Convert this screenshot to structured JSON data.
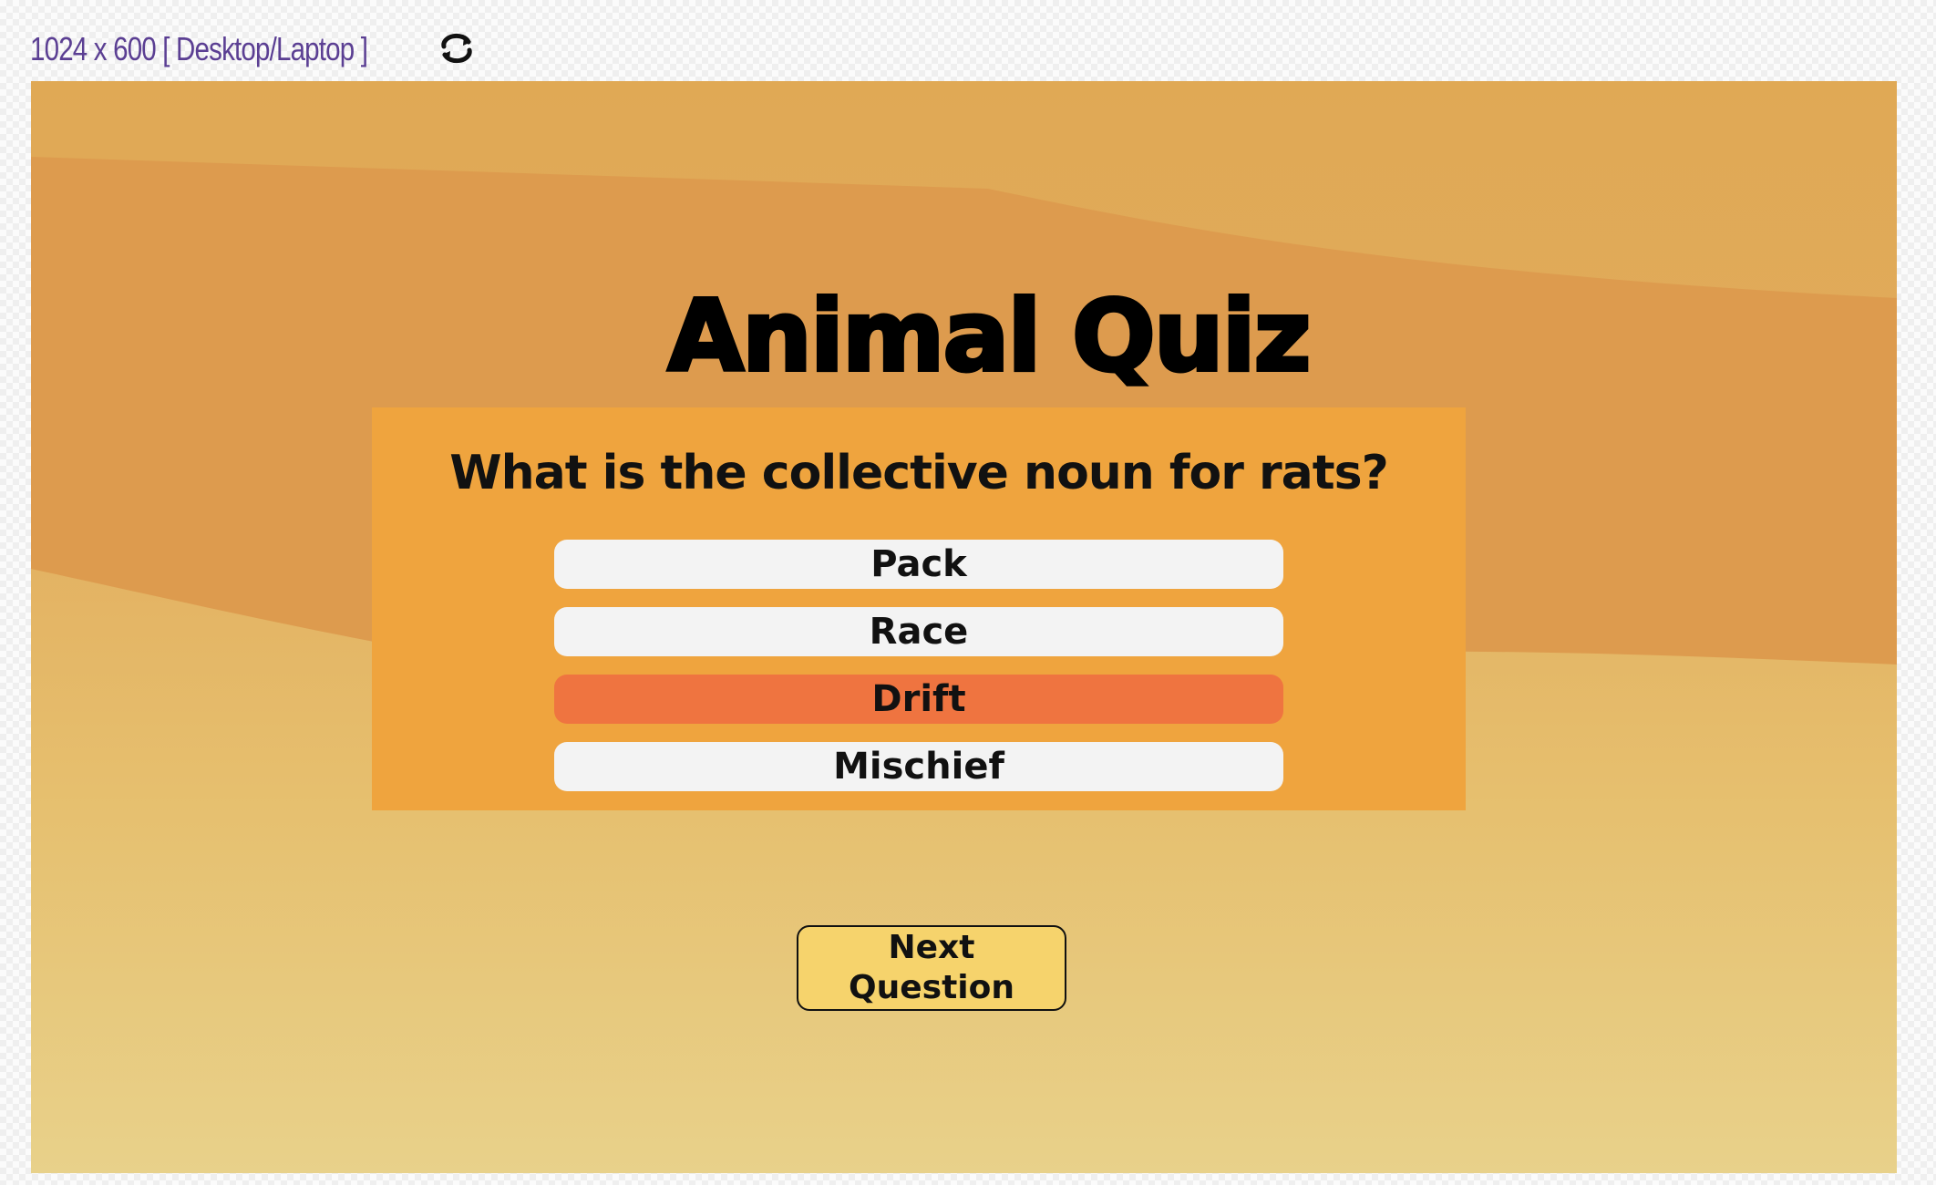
{
  "toolbar": {
    "device_label": "1024 x 600 [ Desktop/Laptop ]",
    "rotate_icon": "rotate-icon"
  },
  "quiz": {
    "title": "Animal Quiz",
    "question": "What is the collective noun for rats?",
    "answers": [
      {
        "label": "Pack",
        "selected": false
      },
      {
        "label": "Race",
        "selected": false
      },
      {
        "label": "Drift",
        "selected": true
      },
      {
        "label": "Mischief",
        "selected": false
      }
    ],
    "next_label": "Next Question"
  },
  "colors": {
    "card": "#efa43e",
    "answer": "#f3f3f3",
    "answer_selected": "#ef7440",
    "next_button": "#f6d36c",
    "device_label": "#5b3f93"
  }
}
